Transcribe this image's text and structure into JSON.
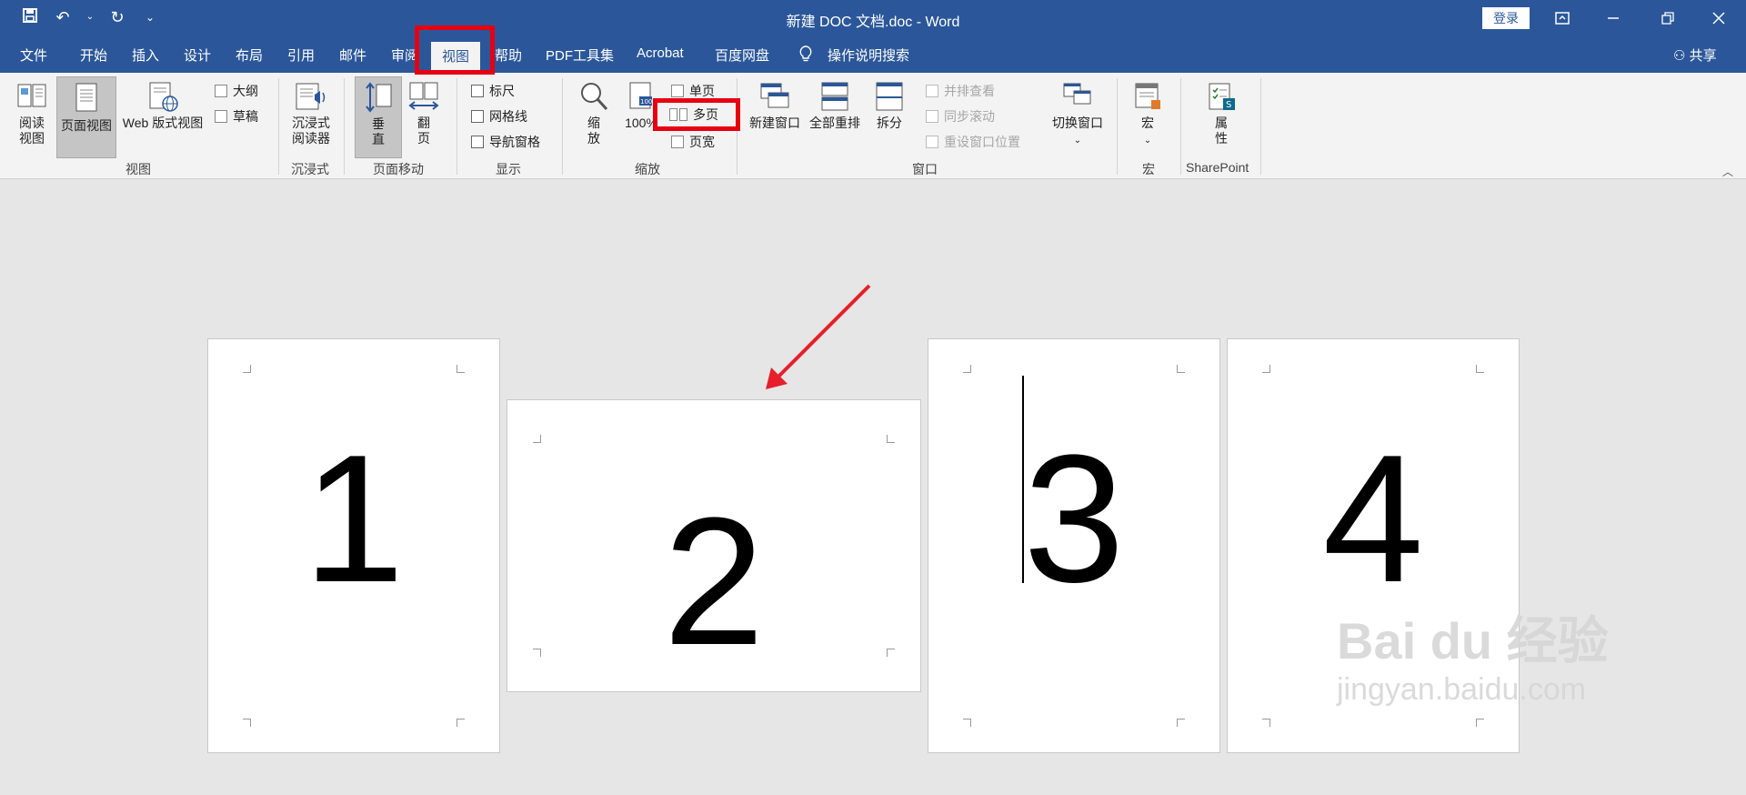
{
  "title_bar": {
    "document_title": "新建 DOC 文档.doc  -  Word",
    "login": "登录",
    "qat_icons": [
      "save-icon",
      "undo-icon",
      "redo-icon",
      "customize-icon"
    ],
    "window_controls": [
      "ribbon-display-icon",
      "minimize-icon",
      "restore-icon",
      "close-icon"
    ]
  },
  "tabs": [
    {
      "label": "文件"
    },
    {
      "label": "开始"
    },
    {
      "label": "插入"
    },
    {
      "label": "设计"
    },
    {
      "label": "布局"
    },
    {
      "label": "引用"
    },
    {
      "label": "邮件"
    },
    {
      "label": "审阅"
    },
    {
      "label": "视图",
      "active": true
    },
    {
      "label": "帮助"
    },
    {
      "label": "PDF工具集"
    },
    {
      "label": "Acrobat"
    },
    {
      "label": "百度网盘"
    },
    {
      "label": "操作说明搜索"
    }
  ],
  "share": "共享",
  "ribbon": {
    "views": {
      "group": "视图",
      "read_mode": "阅读\n视图",
      "read_mode_l1": "阅读",
      "read_mode_l2": "视图",
      "print_layout": "页面视图",
      "web_layout": "Web 版式视图",
      "outline": "大纲",
      "draft": "草稿"
    },
    "immersive": {
      "group": "沉浸式",
      "reader_l1": "沉浸式",
      "reader_l2": "阅读器"
    },
    "page_movement": {
      "group": "页面移动",
      "vertical_l1": "垂",
      "vertical_l2": "直",
      "side_l1": "翻",
      "side_l2": "页"
    },
    "show": {
      "group": "显示",
      "ruler": "标尺",
      "gridlines": "网格线",
      "nav_pane": "导航窗格"
    },
    "zoom": {
      "group": "缩放",
      "zoom_l1": "缩",
      "zoom_l2": "放",
      "hundred": "100%",
      "one_page": "单页",
      "multiple_pages": "多页",
      "page_width": "页宽"
    },
    "window": {
      "group": "窗口",
      "new_window": "新建窗口",
      "arrange_all": "全部重排",
      "split": "拆分",
      "side_by_side": "并排查看",
      "sync_scroll": "同步滚动",
      "reset_pos": "重设窗口位置",
      "switch": "切换窗口"
    },
    "macros": {
      "group": "宏",
      "label": "宏"
    },
    "sharepoint": {
      "group": "SharePoint",
      "prop_l1": "属",
      "prop_l2": "性"
    }
  },
  "pages": [
    {
      "number": "1"
    },
    {
      "number": "2"
    },
    {
      "number": "3"
    },
    {
      "number": "4"
    }
  ],
  "watermark": {
    "brand": "Bai du 经验",
    "url": "jingyan.baidu.com"
  },
  "colors": {
    "titlebar": "#2b579a",
    "highlight": "#e60012",
    "canvas": "#e6e6e6"
  }
}
